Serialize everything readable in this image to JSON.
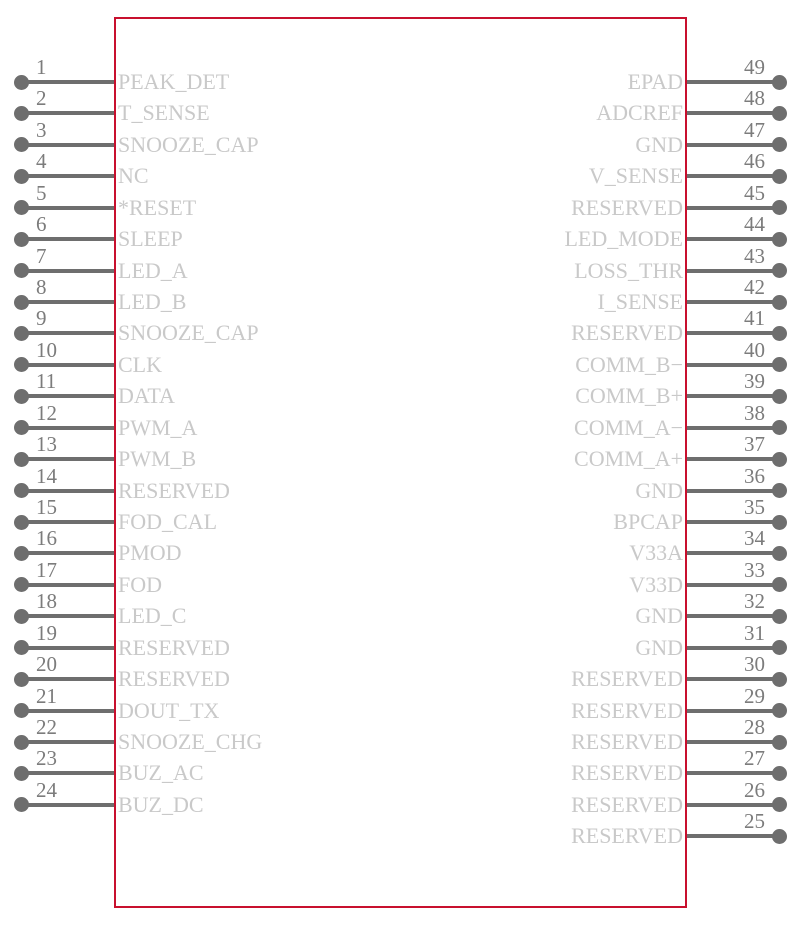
{
  "symbol": {
    "body": {
      "outline_color": "#c8102e",
      "fill": "none"
    },
    "colors": {
      "outline": "#c8102e",
      "wire": "#6e6e6e",
      "pin_dot": "#6e6e6e",
      "pin_number": "#7c7c7c",
      "pin_label": "#c9c9c9",
      "background": "#ffffff"
    },
    "pin_count": 49,
    "left_pins": [
      {
        "number": "1",
        "label": "PEAK_DET"
      },
      {
        "number": "2",
        "label": "T_SENSE"
      },
      {
        "number": "3",
        "label": "SNOOZE_CAP"
      },
      {
        "number": "4",
        "label": "NC"
      },
      {
        "number": "5",
        "label": "*RESET"
      },
      {
        "number": "6",
        "label": "SLEEP"
      },
      {
        "number": "7",
        "label": "LED_A"
      },
      {
        "number": "8",
        "label": "LED_B"
      },
      {
        "number": "9",
        "label": "SNOOZE_CAP"
      },
      {
        "number": "10",
        "label": "CLK"
      },
      {
        "number": "11",
        "label": "DATA"
      },
      {
        "number": "12",
        "label": "PWM_A"
      },
      {
        "number": "13",
        "label": "PWM_B"
      },
      {
        "number": "14",
        "label": "RESERVED"
      },
      {
        "number": "15",
        "label": "FOD_CAL"
      },
      {
        "number": "16",
        "label": "PMOD"
      },
      {
        "number": "17",
        "label": "FOD"
      },
      {
        "number": "18",
        "label": "LED_C"
      },
      {
        "number": "19",
        "label": "RESERVED"
      },
      {
        "number": "20",
        "label": "RESERVED"
      },
      {
        "number": "21",
        "label": "DOUT_TX"
      },
      {
        "number": "22",
        "label": "SNOOZE_CHG"
      },
      {
        "number": "23",
        "label": "BUZ_AC"
      },
      {
        "number": "24",
        "label": "BUZ_DC"
      }
    ],
    "right_pins": [
      {
        "number": "49",
        "label": "EPAD"
      },
      {
        "number": "48",
        "label": "ADCREF"
      },
      {
        "number": "47",
        "label": "GND"
      },
      {
        "number": "46",
        "label": "V_SENSE"
      },
      {
        "number": "45",
        "label": "RESERVED"
      },
      {
        "number": "44",
        "label": "LED_MODE"
      },
      {
        "number": "43",
        "label": "LOSS_THR"
      },
      {
        "number": "42",
        "label": "I_SENSE"
      },
      {
        "number": "41",
        "label": "RESERVED"
      },
      {
        "number": "40",
        "label": "COMM_B−"
      },
      {
        "number": "39",
        "label": "COMM_B+"
      },
      {
        "number": "38",
        "label": "COMM_A−"
      },
      {
        "number": "37",
        "label": "COMM_A+"
      },
      {
        "number": "36",
        "label": "GND"
      },
      {
        "number": "35",
        "label": "BPCAP"
      },
      {
        "number": "34",
        "label": "V33A"
      },
      {
        "number": "33",
        "label": "V33D"
      },
      {
        "number": "32",
        "label": "GND"
      },
      {
        "number": "31",
        "label": "GND"
      },
      {
        "number": "30",
        "label": "RESERVED"
      },
      {
        "number": "29",
        "label": "RESERVED"
      },
      {
        "number": "28",
        "label": "RESERVED"
      },
      {
        "number": "27",
        "label": "RESERVED"
      },
      {
        "number": "26",
        "label": "RESERVED"
      },
      {
        "number": "25",
        "label": "RESERVED"
      }
    ]
  }
}
